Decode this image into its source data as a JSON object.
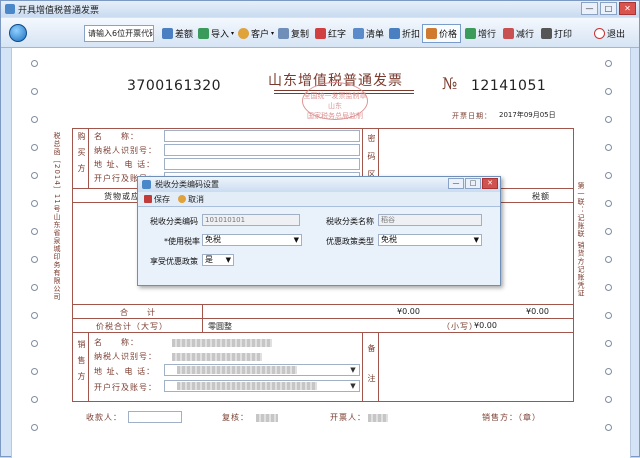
{
  "window": {
    "title": "开具增值税普通发票"
  },
  "toolbar": {
    "code_input": "请输入6位开票代码",
    "buttons": [
      {
        "label": "差额",
        "icon": "difference-icon"
      },
      {
        "label": "导入",
        "icon": "import-icon"
      },
      {
        "label": "客户",
        "icon": "customer-icon"
      },
      {
        "label": "复制",
        "icon": "copy-icon"
      },
      {
        "label": "红字",
        "icon": "red-invoice-icon"
      },
      {
        "label": "清单",
        "icon": "list-icon"
      },
      {
        "label": "折扣",
        "icon": "discount-icon"
      },
      {
        "label": "价格",
        "icon": "price-icon"
      },
      {
        "label": "增行",
        "icon": "add-row-icon"
      },
      {
        "label": "减行",
        "icon": "remove-row-icon"
      },
      {
        "label": "打印",
        "icon": "print-icon"
      },
      {
        "label": "退出",
        "icon": "exit-icon"
      }
    ]
  },
  "invoice": {
    "code": "3700161320",
    "title": "山东增值税普通发票",
    "number_sign": "№",
    "number": "12141051",
    "seal_line1": "全国统一发票监制章",
    "seal_line2": "山东",
    "seal_line3": "国家税务总局监制",
    "date_label": "开票日期：",
    "date": "2017年09月05日",
    "left_side_text": "税总函［2014］11号山东省泉城印务有限公司",
    "right_side_text": "第一联：记账联 销货方记账凭证",
    "buyer_side_label": "购买方",
    "buyer": {
      "name_label": "名　　称：",
      "taxid_label": "纳税人识别号：",
      "address_label": "地 址、电 话：",
      "bank_label": "开户行及账号："
    },
    "password_label": "密码区",
    "goods_header": "货物或应税",
    "tax_header": "税额",
    "total_label": "合　　计",
    "total_amount": "¥0.00",
    "total_tax": "¥0.00",
    "price_total_label": "价税合计（大写）",
    "price_total_chinese": "零圆整",
    "price_total_small_label": "（小写）",
    "price_total_small": "¥0.00",
    "seller_side_label": "销售方",
    "seller": {
      "name_label": "名　　称：",
      "taxid_label": "纳税人识别号：",
      "address_label": "地 址、电 话：",
      "bank_label": "开户行及账号："
    },
    "remark_label": "备注",
    "payee_label": "收款人：",
    "reviewer_label": "复核：",
    "drawer_label": "开票人：",
    "seller_sign_label": "销售方：（章）"
  },
  "dialog": {
    "title": "税收分类编码设置",
    "save": "保存",
    "cancel": "取消",
    "code_label": "税收分类编码",
    "code_value": "101010101",
    "name_label": "税收分类名称",
    "name_value": "稻谷",
    "rate_label": "*使用税率",
    "rate_value": "免税",
    "policy_type_label": "优惠政策类型",
    "policy_type_value": "免税",
    "enjoy_label": "享受优惠政策",
    "enjoy_value": "是"
  }
}
